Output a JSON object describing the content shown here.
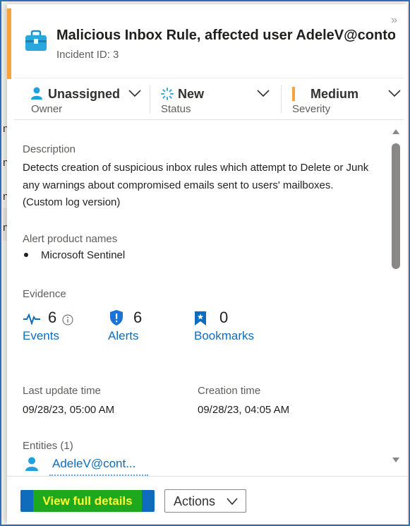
{
  "panel": {
    "title": "Malicious Inbox Rule, affected user AdeleV@conto...",
    "incident_id": "Incident ID: 3",
    "accent_color": "#f4a53b"
  },
  "fields": {
    "owner": {
      "value": "Unassigned",
      "label": "Owner"
    },
    "status": {
      "value": "New",
      "label": "Status"
    },
    "severity": {
      "value": "Medium",
      "label": "Severity",
      "color": "#f4a53b"
    }
  },
  "description": {
    "label": "Description",
    "text": "Detects creation of suspicious inbox rules which attempt to Delete or Junk any warnings about compromised emails sent to users' mailboxes. (Custom log version)"
  },
  "alert_products": {
    "label": "Alert product names",
    "items": [
      "Microsoft Sentinel"
    ]
  },
  "evidence": {
    "label": "Evidence",
    "events": {
      "count": "6",
      "label": "Events"
    },
    "alerts": {
      "count": "6",
      "label": "Alerts"
    },
    "bookmarks": {
      "count": "0",
      "label": "Bookmarks"
    }
  },
  "times": {
    "last_update_label": "Last update time",
    "last_update_value": "09/28/23, 05:00 AM",
    "creation_label": "Creation time",
    "creation_value": "09/28/23, 04:05 AM"
  },
  "entities": {
    "label": "Entities (1)",
    "items": [
      "AdeleV@cont..."
    ]
  },
  "footer": {
    "primary_label": "View full details",
    "actions_label": "Actions"
  },
  "background_fragments": [
    "n",
    "n",
    "n",
    "n"
  ]
}
